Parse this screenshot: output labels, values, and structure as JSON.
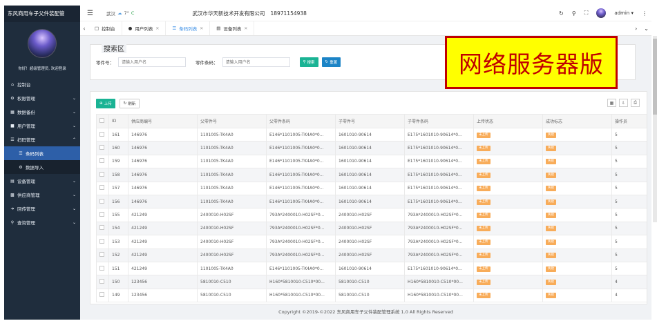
{
  "sidebar": {
    "brand": "东风商用车子父件装配管",
    "welcome": "你好！超级管理员, 欢迎登录",
    "items": [
      {
        "label": "控制台",
        "icon": "home-icon"
      },
      {
        "label": "权限管理",
        "icon": "gear-icon"
      },
      {
        "label": "数据备份",
        "icon": "bank-icon"
      },
      {
        "label": "用户管理",
        "icon": "user-icon"
      },
      {
        "label": "扫码管理",
        "icon": "list-icon"
      },
      {
        "label": "条码列表",
        "icon": "list-icon"
      },
      {
        "label": "数据导入",
        "icon": "gear-icon"
      },
      {
        "label": "设备管理",
        "icon": "device-icon"
      },
      {
        "label": "供应商管理",
        "icon": "card-icon"
      },
      {
        "label": "回传管理",
        "icon": "arrow-icon"
      },
      {
        "label": "查询管理",
        "icon": "search-icon"
      }
    ]
  },
  "topbar": {
    "city": "武汉",
    "temperature": "7°",
    "temp_unit": "C",
    "company": "武汉市华天新技术开发有限公司",
    "phone": "18971154938",
    "user": "admin"
  },
  "tabs": [
    {
      "label": "控制台"
    },
    {
      "label": "用户列表"
    },
    {
      "label": "条码列表"
    },
    {
      "label": "设备列表"
    }
  ],
  "search": {
    "title": "搜索区",
    "part_no_label": "零件号：",
    "part_no_placeholder": "请输入用户名",
    "barcode_label": "零件条码：",
    "barcode_placeholder": "请输入用户名",
    "search_button": "搜索",
    "reset_button": "重置"
  },
  "banner": "网络服务器版",
  "toolbar": {
    "upload_button": "上传",
    "refresh_button": "刷新"
  },
  "table": {
    "columns": [
      "ID",
      "供应商编号",
      "父零件号",
      "父零件条码",
      "子零件号",
      "子零件条码",
      "上传状态",
      "成功标志",
      "操作员"
    ],
    "rows": [
      [
        "161",
        "146976",
        "1101005-TK4A0",
        "E146*1101005-TK4A0*0...",
        "1601010-90614",
        "E175*1601010-90614*0...",
        "未上传",
        "失败",
        "5"
      ],
      [
        "160",
        "146976",
        "1101005-TK4A0",
        "E146*1101005-TK4A0*0...",
        "1601010-90614",
        "E175*1601010-90614*0...",
        "未上传",
        "失败",
        "5"
      ],
      [
        "159",
        "146976",
        "1101005-TK4A0",
        "E146*1101005-TK4A0*0...",
        "1601010-90614",
        "E175*1601010-90614*0...",
        "未上传",
        "失败",
        "5"
      ],
      [
        "158",
        "146976",
        "1101005-TK4A0",
        "E146*1101005-TK4A0*0...",
        "1601010-90614",
        "E175*1601010-90614*0...",
        "未上传",
        "失败",
        "5"
      ],
      [
        "157",
        "146976",
        "1101005-TK4A0",
        "E146*1101005-TK4A0*0...",
        "1601010-90614",
        "E175*1601010-90614*0...",
        "未上传",
        "失败",
        "5"
      ],
      [
        "156",
        "146976",
        "1101005-TK4A0",
        "E146*1101005-TK4A0*0...",
        "1601010-90614",
        "E175*1601010-90614*0...",
        "未上传",
        "失败",
        "5"
      ],
      [
        "155",
        "421249",
        "2400010-H02SF",
        "793A*2400010-H02SF*0...",
        "2400010-H02SF",
        "793A*2400010-H02SF*0...",
        "未上传",
        "失败",
        "5"
      ],
      [
        "154",
        "421249",
        "2400010-H02SF",
        "793A*2400010-H02SF*0...",
        "2400010-H02SF",
        "793A*2400010-H02SF*0...",
        "未上传",
        "失败",
        "5"
      ],
      [
        "153",
        "421249",
        "2400010-H02SF",
        "793A*2400010-H02SF*0...",
        "2400010-H02SF",
        "793A*2400010-H02SF*0...",
        "未上传",
        "失败",
        "5"
      ],
      [
        "152",
        "421249",
        "2400010-H02SF",
        "793A*2400010-H02SF*0...",
        "2400010-H02SF",
        "793A*2400010-H02SF*0...",
        "未上传",
        "失败",
        "5"
      ],
      [
        "151",
        "421249",
        "1101005-TK4A0",
        "E146*1101005-TK4A0*0...",
        "1601010-90614",
        "E175*1601010-90614*0...",
        "未上传",
        "失败",
        "5"
      ],
      [
        "150",
        "123456",
        "5810010-C510",
        "H160*5810010-C510*00...",
        "5810010-C510",
        "H160*5810010-C510*00...",
        "未上传",
        "失败",
        "4"
      ],
      [
        "149",
        "123456",
        "5810010-C510",
        "H160*5810010-C510*00...",
        "5810010-C510",
        "H160*5810010-C510*00...",
        "未上传",
        "失败",
        "4"
      ]
    ]
  },
  "footer": "Copyright ©2019-©2022 东风商用车子父件装配管理系统 1.0 All Rights Reserved",
  "colors": {
    "sidebar_bg": "#1f2d3d",
    "active_menu": "#2d5fa8",
    "tag_orange": "#f8ac59",
    "banner_yellow": "#ffff00",
    "banner_red": "#c00000"
  }
}
